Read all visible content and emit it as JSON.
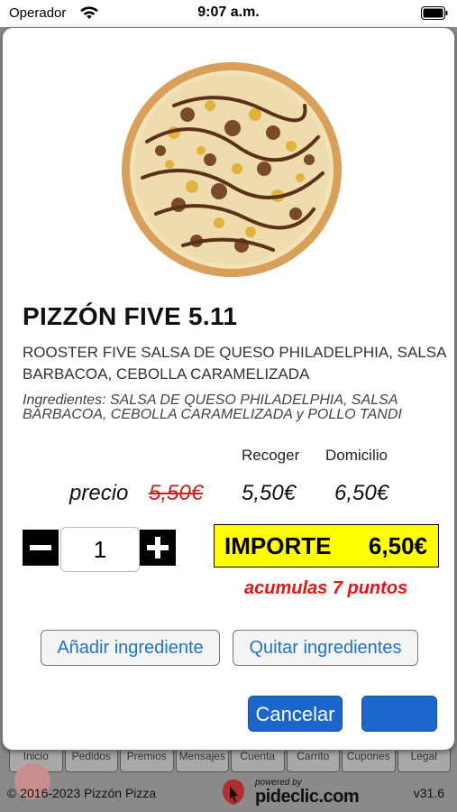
{
  "status_bar": {
    "carrier": "Operador",
    "time": "9:07 a.m."
  },
  "background": {
    "tabs": [
      "Inicio",
      "Pedidos",
      "Premios",
      "Mensajes",
      "Cuenta",
      "Carrito",
      "Cupones",
      "Legal"
    ],
    "copyright": "© 2016-2023  Pizzón Pizza",
    "powered_by": "powered by",
    "brand": "pideclic.com",
    "version": "v31.6"
  },
  "product": {
    "title": "PIZZÓN FIVE 5.11",
    "description": "ROOSTER FIVE SALSA DE QUESO PHILADELPHIA, SALSA BARBACOA, CEBOLLA CARAMELIZADA",
    "ingredients": "Ingredientes: SALSA DE QUESO PHILADELPHIA, SALSA BARBACOA, CEBOLLA CARAMELIZADA y POLLO TANDI"
  },
  "pricing": {
    "col_recoger": "Recoger",
    "col_domicilio": "Domicilio",
    "label": "precio",
    "old_price": "5,50€",
    "recoger_price": "5,50€",
    "domicilio_price": "6,50€"
  },
  "order": {
    "quantity": "1",
    "importe_label": "IMPORTE",
    "importe_value": "6,50€",
    "points_text": "acumulas 7 puntos"
  },
  "buttons": {
    "add_ingredient": "Añadir ingrediente",
    "remove_ingredients": "Quitar ingredientes",
    "cancel": "Cancelar",
    "confirm": ""
  },
  "colors": {
    "accent_blue": "#1a66cc",
    "importe_bg": "#ffff00",
    "points_red": "#e11111",
    "old_price_red": "#d01c1c"
  },
  "icons": [
    "wifi-icon",
    "battery-icon",
    "minus-icon",
    "plus-icon",
    "bell-icon",
    "pideclic-logo-icon"
  ]
}
